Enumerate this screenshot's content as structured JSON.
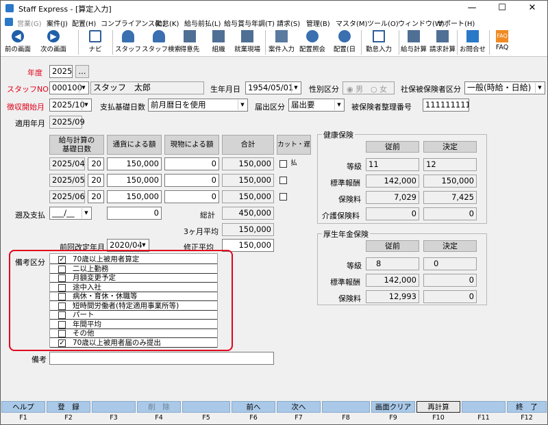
{
  "app": {
    "title": "Staff Express - [算定入力]"
  },
  "window": {
    "minimize": "—",
    "maximize": "☐",
    "close": "✕"
  },
  "menu": [
    "営業(G)",
    "案件(J)",
    "配置(H)",
    "コンプライアンス(C)",
    "勤怠(K)",
    "給与前払(L)",
    "給与賞与年調(T)",
    "請求(S)",
    "管理(B)",
    "マスタ(M)",
    "ツール(O)",
    "ウィンドウ(W)",
    "サポート(H)"
  ],
  "toolbar": [
    {
      "label": "前の画面",
      "icon": "left-arrow-icon"
    },
    {
      "label": "次の画面",
      "icon": "right-arrow-icon"
    },
    {
      "label": "ナビ",
      "icon": "navi-icon"
    },
    {
      "label": "スタッフ",
      "icon": "staff-icon"
    },
    {
      "label": "スタッフ検索",
      "icon": "staff-search-icon"
    },
    {
      "label": "得意先",
      "icon": "client-icon"
    },
    {
      "label": "組織",
      "icon": "organization-icon"
    },
    {
      "label": "就業現場",
      "icon": "worksite-icon"
    },
    {
      "label": "案件入力",
      "icon": "job-entry-icon"
    },
    {
      "label": "配置照会",
      "icon": "assignment-inquiry-icon"
    },
    {
      "label": "配置(日",
      "icon": "assignment-daily-icon"
    },
    {
      "label": "勤怠入力",
      "icon": "attendance-entry-icon"
    },
    {
      "label": "給与計算",
      "icon": "payroll-calc-icon"
    },
    {
      "label": "請求計算",
      "icon": "billing-calc-icon"
    },
    {
      "label": "お問合せ",
      "icon": "inquiry-icon"
    },
    {
      "label": "FAQ",
      "icon": "faq-icon"
    }
  ],
  "form": {
    "year_label": "年度",
    "year": "2025",
    "year_btn": "...",
    "staff_label": "スタッフNO",
    "staff_no": "000100",
    "staff_name": "スタッフ　太郎",
    "birth_label": "生年月日",
    "birth": "1954/05/01",
    "sex_label": "性別区分",
    "male": "男",
    "female": "女",
    "ins_kbn_label": "社保被保険者区分",
    "ins_kbn": "一般(時給・日給)",
    "collect_label": "徴収開始月",
    "collect": "2025/10",
    "paybase_label": "支払基礎日数",
    "paybase": "前月暦日を使用",
    "notify_label": "届出区分",
    "notify": "届出要",
    "insno_label": "被保険者整理番号",
    "insno": "1111111111",
    "apply_label": "適用年月",
    "apply": "2025/09"
  },
  "table": {
    "headers": [
      "給与計算の\n基礎日数",
      "通貨による額",
      "現物による額",
      "合計",
      "カット・遅払"
    ],
    "rows": [
      {
        "month": "2025/04",
        "days": "20",
        "cash": "150,000",
        "kind": "0",
        "total": "150,000"
      },
      {
        "month": "2025/05",
        "days": "20",
        "cash": "150,000",
        "kind": "0",
        "total": "150,000"
      },
      {
        "month": "2025/06",
        "days": "20",
        "cash": "150,000",
        "kind": "0",
        "total": "150,000"
      }
    ],
    "retro_label": "遡及支払",
    "retro_month": "___/__",
    "retro_amount": "0",
    "sum_label": "総計",
    "sum": "450,000",
    "avg_label": "3ヶ月平均",
    "avg": "150,000",
    "prev_label": "前回改定年月",
    "prev": "2020/04",
    "adj_label": "修正平均",
    "adj": "150,000"
  },
  "health": {
    "title": "健康保険",
    "before": "従前",
    "decided": "決定",
    "rows": [
      {
        "label": "等級",
        "before": "11",
        "decided": "12"
      },
      {
        "label": "標準報酬",
        "before": "142,000",
        "decided": "150,000"
      },
      {
        "label": "保険料",
        "before": "7,029",
        "decided": "7,425"
      },
      {
        "label": "介護保険料",
        "before": "0",
        "decided": "0"
      }
    ]
  },
  "pension": {
    "title": "厚生年金保険",
    "before": "従前",
    "decided": "決定",
    "rows": [
      {
        "label": "等級",
        "before": "8",
        "decided": "0"
      },
      {
        "label": "標準報酬",
        "before": "142,000",
        "decided": "0"
      },
      {
        "label": "保険料",
        "before": "12,993",
        "decided": "0"
      }
    ]
  },
  "remarks": {
    "label": "備考区分",
    "items": [
      {
        "text": "70歳以上被用者算定",
        "checked": true
      },
      {
        "text": "二以上勤務",
        "checked": false
      },
      {
        "text": "月額変更予定",
        "checked": false
      },
      {
        "text": "途中入社",
        "checked": false
      },
      {
        "text": "病休・育休・休職等",
        "checked": false
      },
      {
        "text": "短時間労働者(特定適用事業所等)",
        "checked": false
      },
      {
        "text": "パート",
        "checked": false
      },
      {
        "text": "年間平均",
        "checked": false
      },
      {
        "text": "その他",
        "checked": false
      },
      {
        "text": "70歳以上被用者届のみ提出",
        "checked": true
      }
    ],
    "note_label": "備考",
    "note": ""
  },
  "fkeys": [
    {
      "label": "ヘルプ",
      "key": "F1"
    },
    {
      "label": "登　録",
      "key": "F2"
    },
    {
      "label": "",
      "key": "F3"
    },
    {
      "label": "削　除",
      "key": "F4"
    },
    {
      "label": "",
      "key": "F5"
    },
    {
      "label": "前へ",
      "key": "F6"
    },
    {
      "label": "次へ",
      "key": "F7"
    },
    {
      "label": "",
      "key": "F8"
    },
    {
      "label": "画面クリア",
      "key": "F9"
    },
    {
      "label": "再計算",
      "key": "F10"
    },
    {
      "label": "",
      "key": "F11"
    },
    {
      "label": "終　了",
      "key": "F12"
    }
  ],
  "colors": {
    "required_label": "#e0001a",
    "highlight_border": "#e0001a",
    "fkey_bg": "#aac9e8"
  }
}
